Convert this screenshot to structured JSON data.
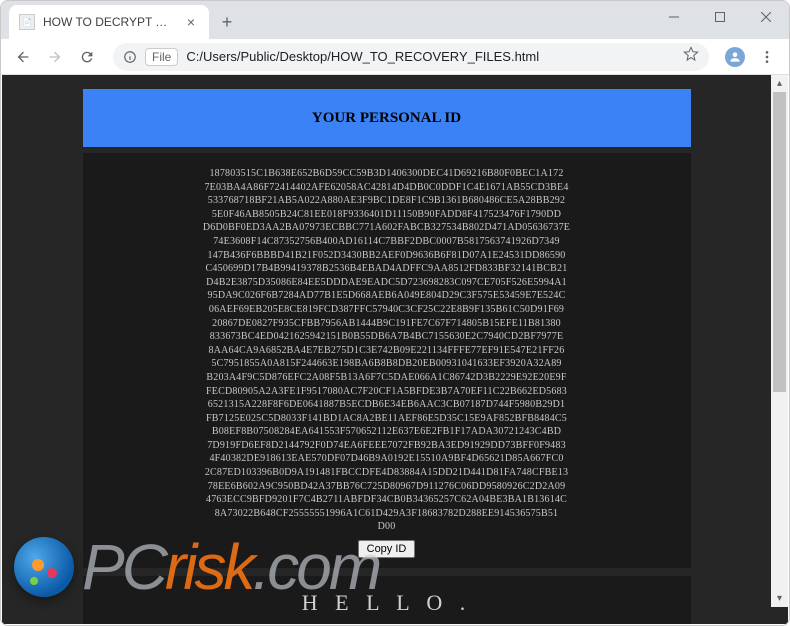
{
  "browser": {
    "tab_title": "HOW TO DECRYPT YOUR FILES",
    "address_scheme": "File",
    "address_path": "C:/Users/Public/Desktop/HOW_TO_RECOVERY_FILES.html"
  },
  "page": {
    "header_title": "YOUR PERSONAL ID",
    "personal_id": "187803515C1B638E652B6D59CC59B3D1406300DEC41D69216B80F0BEC1A1727E03BA4A86F72414402AFE62058AC42814D4DB0C0DDF1C4E1671AB55CD3BE4533768718BF21AB5A022A880AE3F9BC1DE8F1C9B1361B680486CE5A28BB2925E0F46AB8505B24C81EE018F9336401D11150B90FADD8F417523476F1790DDD6D0BF0ED3AA2BA07973ECBBC771A602FABCB327534B802D471AD05636737E74E3608F14C87352756B400AD16114C7BBF2DBC0007B5817563741926D7349147B436F6BBBD41B21F052D3430BB2AEF0D9636B6F81D07A1E24531DD86590C450699D17B4B99419378B2536B4EBAD4ADFFC9AA8512FD833BF32141BCB21D4B2E3875D35086E84EE5DDDAE9EADC5D723698283C097CE705F526E5994A195DA9C026F6B7284AD77B1E5D668AEB6A049E804D29C3F575E53459E7E524C06AEF69EB205E8CE819FCD387FFC57940C3CF25C22E8B9F135B61C50D91F6920867DE0827F935CFBB7956AB1444B9C191FE7C67F714805B15EFE11B81380833673BC4ED042162594215 1B0B55DB6A7B4BC7155630E2C7940CD2BF7977E8AA64CA9A6852BA4E7EB275D1C3E742B09E221134FFFE77EF91E547E21FF265C7951855A0A815F244663E198BA6B8B8DB20EB00931041633EF3920A32A89B203A4F9C5D876EFC2A08F5B13A6F7C5DAE066A1C86742D3B2229E92E20E9FFECD80905A2A3FE1F9517080AC7F20CF1A5BFDE3B7A70EF11C22B662ED56836521315A228F8F6DE0641887B5ECDB6E34EB6AAC3CB07187D744F5980B29D1FB7125E025C5D8033F141BD1AC8A2BE11AEF86E5D35C15E9AF852BFB8484C5B08EF8B07508284EA641553F570652112E637E6E2FB1F17ADA30721243C4BD7D919FD6EF8D2144792F0D74EA6FEEE7072FB92BA3ED91929DD73BFF0F94834F40382DE918613EAE570DF07D46B9A0192E15510A9BF4D65621D85A667FC02C87ED103396B0D9A191481FBCCDFE4D83884A15DD21D441D81FA748CFBE1378EE6B602A9C950BD42A37BB76C725D80967D911276C06DD9580926C2D2A094763ECC9BFD9201F7C4B2711ABFDF34CB0B34365257C62A04BE3BA1B13614C8A73022B648CF25555551996A1C61D429A3F18683782D288EE914536575B5 1D00",
    "copy_button_label": "Copy ID",
    "hello_label": "H E L L O ."
  },
  "watermark": {
    "part1": "PC",
    "part2": "risk",
    "part3": ".com"
  }
}
